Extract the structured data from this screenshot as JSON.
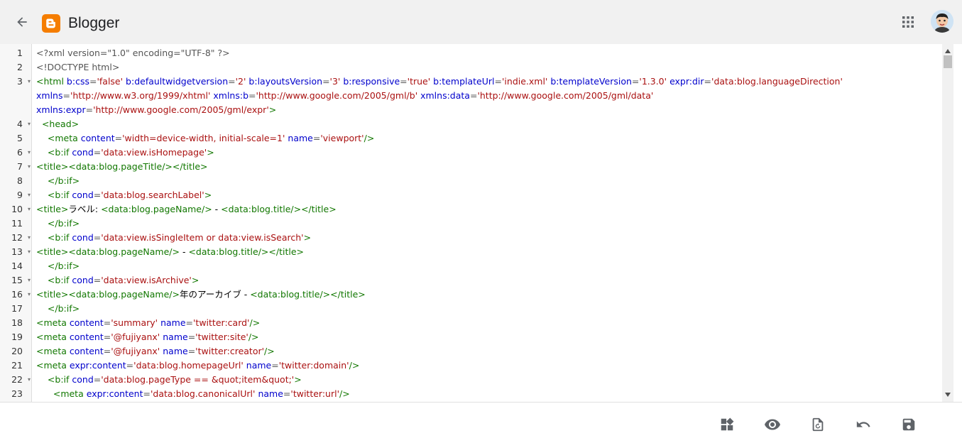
{
  "header": {
    "title": "Blogger",
    "logo_color": "#f57d00"
  },
  "icons": {
    "back": "arrow-left-icon",
    "apps": "grid-apps-icon",
    "avatar": "user-avatar",
    "layout": "layout-widgets-icon",
    "preview": "eye-icon",
    "restore": "file-restore-icon",
    "undo": "undo-icon",
    "save": "save-icon"
  },
  "editor": {
    "lines": [
      {
        "num": "1",
        "fold": "",
        "indent": "",
        "tokens": [
          [
            "plain",
            "<?xml version=\"1.0\" encoding=\"UTF-8\" ?>"
          ]
        ]
      },
      {
        "num": "2",
        "fold": "",
        "indent": "",
        "tokens": [
          [
            "plain",
            "<!DOCTYPE html>"
          ]
        ]
      },
      {
        "num": "3",
        "fold": "▾",
        "indent": "",
        "tokens": [
          [
            "tag",
            "<html "
          ],
          [
            "attr",
            "b:css"
          ],
          [
            "plain",
            "="
          ],
          [
            "str",
            "'false'"
          ],
          [
            "plain",
            " "
          ],
          [
            "attr",
            "b:defaultwidgetversion"
          ],
          [
            "plain",
            "="
          ],
          [
            "str",
            "'2'"
          ],
          [
            "plain",
            " "
          ],
          [
            "attr",
            "b:layoutsVersion"
          ],
          [
            "plain",
            "="
          ],
          [
            "str",
            "'3'"
          ],
          [
            "plain",
            " "
          ],
          [
            "attr",
            "b:responsive"
          ],
          [
            "plain",
            "="
          ],
          [
            "str",
            "'true'"
          ],
          [
            "plain",
            " "
          ],
          [
            "attr",
            "b:templateUrl"
          ],
          [
            "plain",
            "="
          ],
          [
            "str",
            "'indie.xml'"
          ],
          [
            "plain",
            " "
          ],
          [
            "attr",
            "b:templateVersion"
          ],
          [
            "plain",
            "="
          ],
          [
            "str",
            "'1.3.0'"
          ],
          [
            "plain",
            " "
          ],
          [
            "attr",
            "expr:dir"
          ],
          [
            "plain",
            "="
          ],
          [
            "str",
            "'data:blog.languageDirection'"
          ]
        ]
      },
      {
        "num": "",
        "fold": "",
        "indent": "",
        "tokens": [
          [
            "attr",
            "xmlns"
          ],
          [
            "plain",
            "="
          ],
          [
            "str",
            "'http://www.w3.org/1999/xhtml'"
          ],
          [
            "plain",
            " "
          ],
          [
            "attr",
            "xmlns:b"
          ],
          [
            "plain",
            "="
          ],
          [
            "str",
            "'http://www.google.com/2005/gml/b'"
          ],
          [
            "plain",
            " "
          ],
          [
            "attr",
            "xmlns:data"
          ],
          [
            "plain",
            "="
          ],
          [
            "str",
            "'http://www.google.com/2005/gml/data'"
          ]
        ]
      },
      {
        "num": "",
        "fold": "",
        "indent": "",
        "tokens": [
          [
            "attr",
            "xmlns:expr"
          ],
          [
            "plain",
            "="
          ],
          [
            "str",
            "'http://www.google.com/2005/gml/expr'"
          ],
          [
            "tag",
            ">"
          ]
        ]
      },
      {
        "num": "4",
        "fold": "▾",
        "indent": "  ",
        "tokens": [
          [
            "tag",
            "<head>"
          ]
        ]
      },
      {
        "num": "5",
        "fold": "",
        "indent": "    ",
        "tokens": [
          [
            "tag",
            "<meta "
          ],
          [
            "attr",
            "content"
          ],
          [
            "plain",
            "="
          ],
          [
            "str",
            "'width=device-width, initial-scale=1'"
          ],
          [
            "plain",
            " "
          ],
          [
            "attr",
            "name"
          ],
          [
            "plain",
            "="
          ],
          [
            "str",
            "'viewport'"
          ],
          [
            "tag",
            "/>"
          ]
        ]
      },
      {
        "num": "6",
        "fold": "▾",
        "indent": "    ",
        "tokens": [
          [
            "tag",
            "<b:if "
          ],
          [
            "attr",
            "cond"
          ],
          [
            "plain",
            "="
          ],
          [
            "str",
            "'data:view.isHomepage'"
          ],
          [
            "tag",
            ">"
          ]
        ]
      },
      {
        "num": "7",
        "fold": "▾",
        "indent": "",
        "tokens": [
          [
            "tag",
            "<title>"
          ],
          [
            "tag",
            "<data:blog.pageTitle/>"
          ],
          [
            "tag",
            "</title>"
          ]
        ]
      },
      {
        "num": "8",
        "fold": "",
        "indent": "    ",
        "tokens": [
          [
            "tag",
            "</b:if>"
          ]
        ]
      },
      {
        "num": "9",
        "fold": "▾",
        "indent": "    ",
        "tokens": [
          [
            "tag",
            "<b:if "
          ],
          [
            "attr",
            "cond"
          ],
          [
            "plain",
            "="
          ],
          [
            "str",
            "'data:blog.searchLabel'"
          ],
          [
            "tag",
            ">"
          ]
        ]
      },
      {
        "num": "10",
        "fold": "▾",
        "indent": "",
        "tokens": [
          [
            "tag",
            "<title>"
          ],
          [
            "text",
            "ラベル: "
          ],
          [
            "tag",
            "<data:blog.pageName/>"
          ],
          [
            "text",
            " - "
          ],
          [
            "tag",
            "<data:blog.title/>"
          ],
          [
            "tag",
            "</title>"
          ]
        ]
      },
      {
        "num": "11",
        "fold": "",
        "indent": "    ",
        "tokens": [
          [
            "tag",
            "</b:if>"
          ]
        ]
      },
      {
        "num": "12",
        "fold": "▾",
        "indent": "    ",
        "tokens": [
          [
            "tag",
            "<b:if "
          ],
          [
            "attr",
            "cond"
          ],
          [
            "plain",
            "="
          ],
          [
            "str",
            "'data:view.isSingleItem or data:view.isSearch'"
          ],
          [
            "tag",
            ">"
          ]
        ]
      },
      {
        "num": "13",
        "fold": "▾",
        "indent": "",
        "tokens": [
          [
            "tag",
            "<title>"
          ],
          [
            "tag",
            "<data:blog.pageName/>"
          ],
          [
            "text",
            " - "
          ],
          [
            "tag",
            "<data:blog.title/>"
          ],
          [
            "tag",
            "</title>"
          ]
        ]
      },
      {
        "num": "14",
        "fold": "",
        "indent": "    ",
        "tokens": [
          [
            "tag",
            "</b:if>"
          ]
        ]
      },
      {
        "num": "15",
        "fold": "▾",
        "indent": "    ",
        "tokens": [
          [
            "tag",
            "<b:if "
          ],
          [
            "attr",
            "cond"
          ],
          [
            "plain",
            "="
          ],
          [
            "str",
            "'data:view.isArchive'"
          ],
          [
            "tag",
            ">"
          ]
        ]
      },
      {
        "num": "16",
        "fold": "▾",
        "indent": "",
        "tokens": [
          [
            "tag",
            "<title>"
          ],
          [
            "tag",
            "<data:blog.pageName/>"
          ],
          [
            "text",
            "年のアーカイブ - "
          ],
          [
            "tag",
            "<data:blog.title/>"
          ],
          [
            "tag",
            "</title>"
          ]
        ]
      },
      {
        "num": "17",
        "fold": "",
        "indent": "    ",
        "tokens": [
          [
            "tag",
            "</b:if>"
          ]
        ]
      },
      {
        "num": "18",
        "fold": "",
        "indent": "",
        "tokens": [
          [
            "tag",
            "<meta "
          ],
          [
            "attr",
            "content"
          ],
          [
            "plain",
            "="
          ],
          [
            "str",
            "'summary'"
          ],
          [
            "plain",
            " "
          ],
          [
            "attr",
            "name"
          ],
          [
            "plain",
            "="
          ],
          [
            "str",
            "'twitter:card'"
          ],
          [
            "tag",
            "/>"
          ]
        ]
      },
      {
        "num": "19",
        "fold": "",
        "indent": "",
        "tokens": [
          [
            "tag",
            "<meta "
          ],
          [
            "attr",
            "content"
          ],
          [
            "plain",
            "="
          ],
          [
            "str",
            "'@fujiyanx'"
          ],
          [
            "plain",
            " "
          ],
          [
            "attr",
            "name"
          ],
          [
            "plain",
            "="
          ],
          [
            "str",
            "'twitter:site'"
          ],
          [
            "tag",
            "/>"
          ]
        ]
      },
      {
        "num": "20",
        "fold": "",
        "indent": "",
        "tokens": [
          [
            "tag",
            "<meta "
          ],
          [
            "attr",
            "content"
          ],
          [
            "plain",
            "="
          ],
          [
            "str",
            "'@fujiyanx'"
          ],
          [
            "plain",
            " "
          ],
          [
            "attr",
            "name"
          ],
          [
            "plain",
            "="
          ],
          [
            "str",
            "'twitter:creator'"
          ],
          [
            "tag",
            "/>"
          ]
        ]
      },
      {
        "num": "21",
        "fold": "",
        "indent": "",
        "tokens": [
          [
            "tag",
            "<meta "
          ],
          [
            "attr",
            "expr:content"
          ],
          [
            "plain",
            "="
          ],
          [
            "str",
            "'data:blog.homepageUrl'"
          ],
          [
            "plain",
            " "
          ],
          [
            "attr",
            "name"
          ],
          [
            "plain",
            "="
          ],
          [
            "str",
            "'twitter:domain'"
          ],
          [
            "tag",
            "/>"
          ]
        ]
      },
      {
        "num": "22",
        "fold": "▾",
        "indent": "    ",
        "tokens": [
          [
            "tag",
            "<b:if "
          ],
          [
            "attr",
            "cond"
          ],
          [
            "plain",
            "="
          ],
          [
            "str",
            "'data:blog.pageType == &quot;item&quot;'"
          ],
          [
            "tag",
            ">"
          ]
        ]
      },
      {
        "num": "23",
        "fold": "",
        "indent": "      ",
        "tokens": [
          [
            "tag",
            "<meta "
          ],
          [
            "attr",
            "expr:content"
          ],
          [
            "plain",
            "="
          ],
          [
            "str",
            "'data:blog.canonicalUrl'"
          ],
          [
            "plain",
            " "
          ],
          [
            "attr",
            "name"
          ],
          [
            "plain",
            "="
          ],
          [
            "str",
            "'twitter:url'"
          ],
          [
            "tag",
            "/>"
          ]
        ]
      }
    ]
  }
}
